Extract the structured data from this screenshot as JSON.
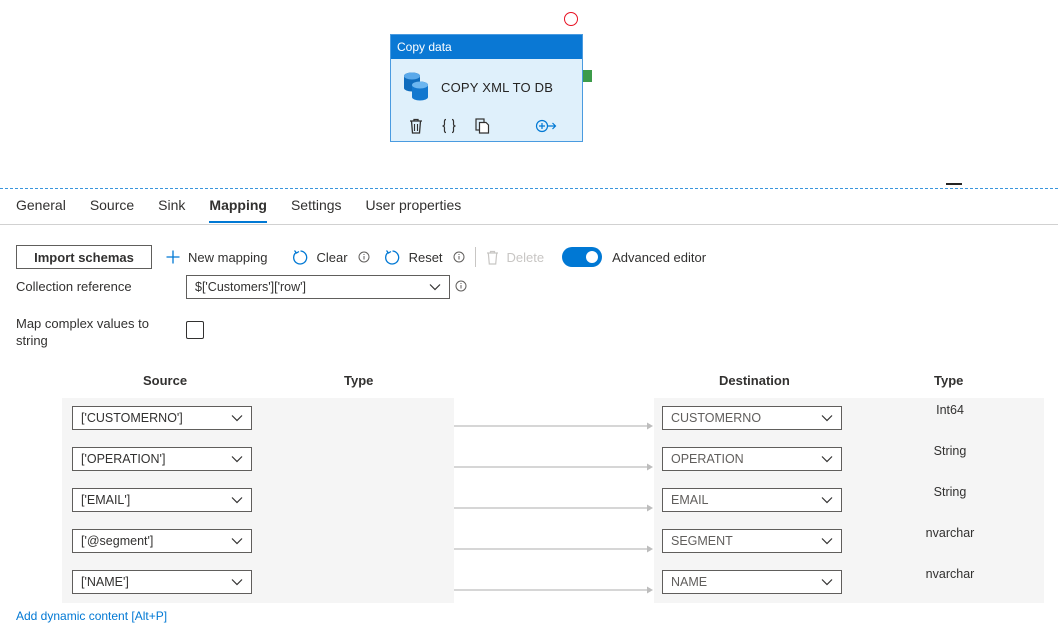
{
  "activity": {
    "header": "Copy data",
    "name": "COPY XML TO DB",
    "icon": "copy-data-database-icon",
    "actions": [
      "delete-icon",
      "code-braces-icon",
      "clone-icon",
      "add-output-icon"
    ]
  },
  "tabs": [
    {
      "label": "General",
      "active": false
    },
    {
      "label": "Source",
      "active": false
    },
    {
      "label": "Sink",
      "active": false
    },
    {
      "label": "Mapping",
      "active": true
    },
    {
      "label": "Settings",
      "active": false
    },
    {
      "label": "User properties",
      "active": false
    }
  ],
  "toolbar": {
    "import_schemas": "Import schemas",
    "new_mapping": "New mapping",
    "clear": "Clear",
    "reset": "Reset",
    "delete": "Delete",
    "advanced_editor": "Advanced editor",
    "advanced_editor_on": true
  },
  "form": {
    "collection_reference_label": "Collection reference",
    "collection_reference_value": "$['Customers']['row']",
    "map_complex_label_line1": "Map complex values to",
    "map_complex_label_line2": "string",
    "map_complex_checked": false
  },
  "mapping": {
    "headers": {
      "source": "Source",
      "source_type": "Type",
      "destination": "Destination",
      "destination_type": "Type"
    },
    "rows": [
      {
        "source": "['CUSTOMERNO']",
        "destination": "CUSTOMERNO",
        "type": "Int64"
      },
      {
        "source": "['OPERATION']",
        "destination": "OPERATION",
        "type": "String"
      },
      {
        "source": "['EMAIL']",
        "destination": "EMAIL",
        "type": "String"
      },
      {
        "source": "['@segment']",
        "destination": "SEGMENT",
        "type": "nvarchar"
      },
      {
        "source": "['NAME']",
        "destination": "NAME",
        "type": "nvarchar"
      }
    ]
  },
  "add_dynamic_content": "Add dynamic content [Alt+P]",
  "colors": {
    "accent": "#0078d4",
    "activity_header": "#0a78d4",
    "activity_bg": "#dff0fb",
    "error": "#e81123",
    "success_port": "#3c9b4a"
  }
}
